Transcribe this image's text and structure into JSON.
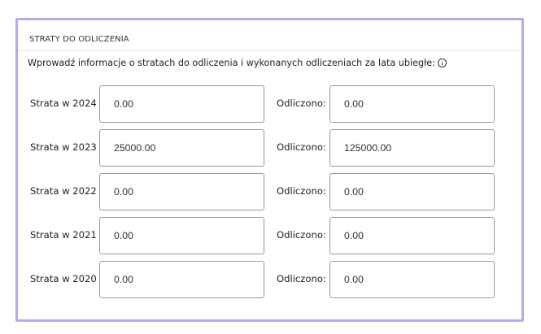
{
  "section": {
    "title": "STRATY DO ODLICZENIA",
    "description": "Wprowadź informacje o stratach do odliczenia i wykonanych odliczeniach za lata ubiegłe:",
    "info_icon": "info-circle-icon"
  },
  "rows": [
    {
      "year_label": "Strata w 2024",
      "loss_value": "0.00",
      "deducted_label": "Odliczono:",
      "deducted_value": "0.00"
    },
    {
      "year_label": "Strata w 2023",
      "loss_value": "25000.00",
      "deducted_label": "Odliczono:",
      "deducted_value": "125000.00"
    },
    {
      "year_label": "Strata w 2022",
      "loss_value": "0.00",
      "deducted_label": "Odliczono:",
      "deducted_value": "0.00"
    },
    {
      "year_label": "Strata w 2021",
      "loss_value": "0.00",
      "deducted_label": "Odliczono:",
      "deducted_value": "0.00"
    },
    {
      "year_label": "Strata w 2020",
      "loss_value": "0.00",
      "deducted_label": "Odliczono:",
      "deducted_value": "0.00"
    }
  ],
  "colors": {
    "frame_border": "#b8aaf2",
    "field_border": "#9a9a9a",
    "divider": "#e4e4e4"
  }
}
